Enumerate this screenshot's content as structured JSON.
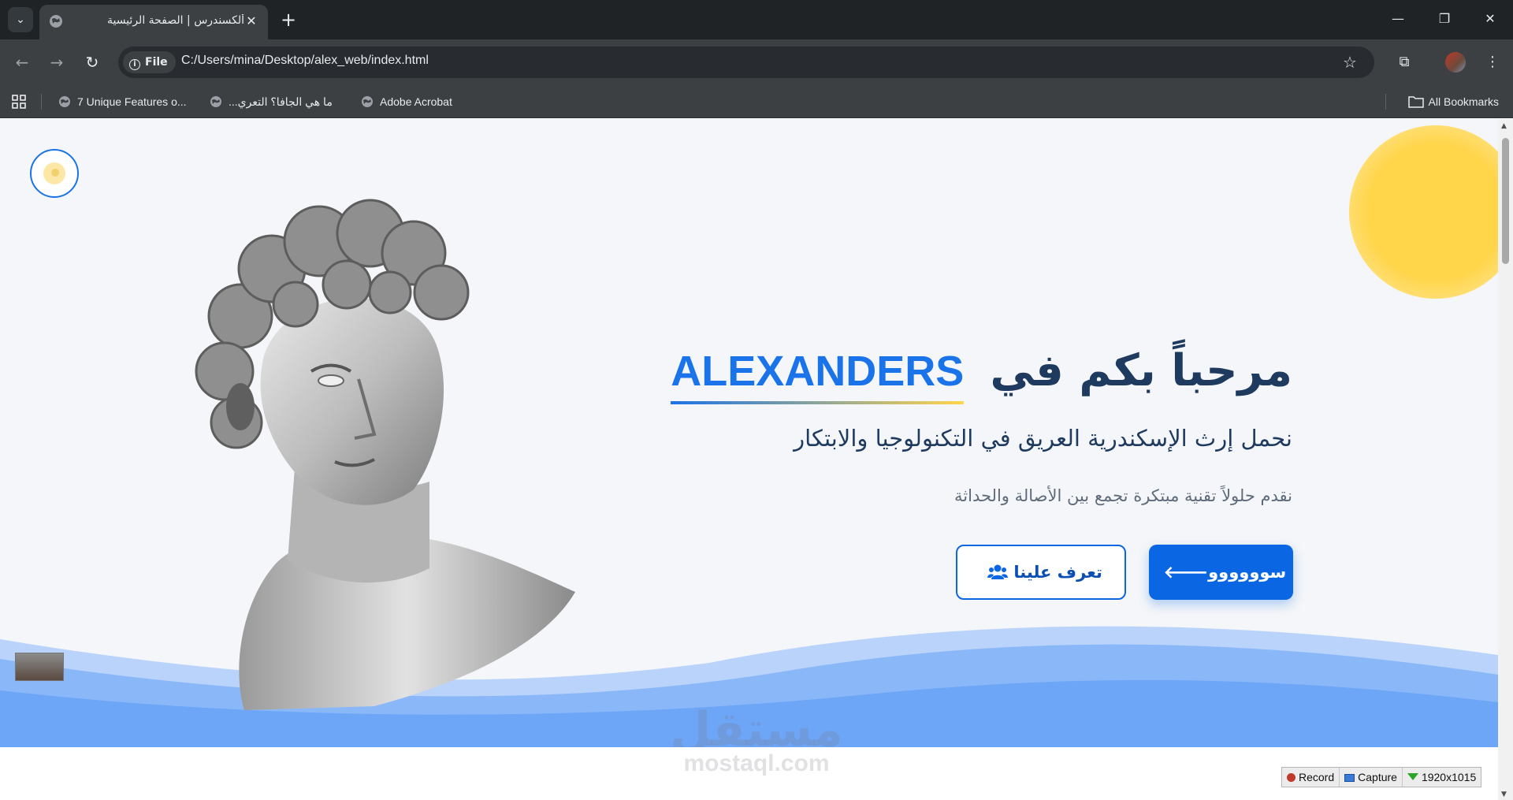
{
  "browser": {
    "tab_title": "ألكسندرس | الصفحة الرئيسية",
    "tab_close": "✕",
    "new_tab": "+",
    "file_chip": "File",
    "url": "C:/Users/mina/Desktop/alex_web/index.html",
    "bookmarks": [
      {
        "label": "7 Unique Features o..."
      },
      {
        "label": "ما هي الجافا؟ التعري..."
      },
      {
        "label": "Adobe Acrobat"
      }
    ],
    "all_bookmarks": "All Bookmarks"
  },
  "hero": {
    "title_ar": "مرحباً بكم في",
    "title_en": "ALEXANDERS",
    "subtitle": "نحمل إرث الإسكندرية العريق في التكنولوجيا والابتكار",
    "description": "نقدم حلولاً تقنية مبتكرة تجمع بين الأصالة والحداثة",
    "primary_button": "سوووووو",
    "secondary_button": "تعرف علينا"
  },
  "watermark": {
    "arabic": "مستقل",
    "latin": "mostaql.com"
  },
  "recorder": {
    "record": "Record",
    "capture": "Capture",
    "resolution": "1920x1015"
  },
  "colors": {
    "accent": "#0b66e4",
    "heading": "#1e3a5f",
    "sun": "#ffd54a",
    "wave": "#6ea6f7"
  }
}
